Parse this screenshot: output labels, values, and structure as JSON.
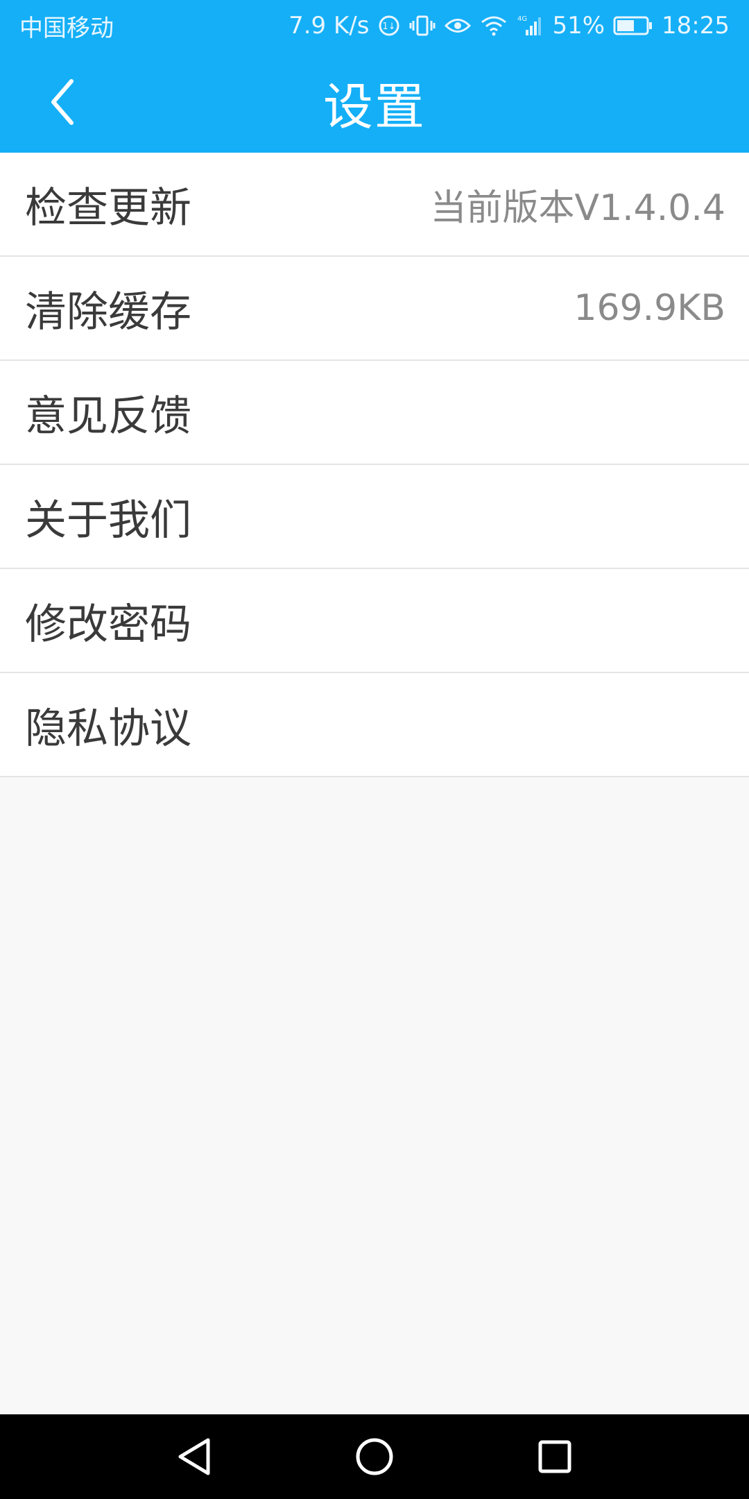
{
  "status_bar": {
    "carrier": "中国移动",
    "net_speed": "7.9 K/s",
    "signal_type": "4G",
    "battery": "51%",
    "time": "18:25",
    "icons": [
      "data-saver-icon",
      "vibrate-icon",
      "eye-comfort-icon",
      "wifi-icon",
      "cellular-signal-icon",
      "battery-icon"
    ]
  },
  "header": {
    "title": "设置",
    "back_icon": "chevron-left-icon"
  },
  "settings": {
    "items": [
      {
        "label": "检查更新",
        "value": "当前版本V1.4.0.4"
      },
      {
        "label": "清除缓存",
        "value": "169.9KB"
      },
      {
        "label": "意见反馈",
        "value": ""
      },
      {
        "label": "关于我们",
        "value": ""
      },
      {
        "label": "修改密码",
        "value": ""
      },
      {
        "label": "隐私协议",
        "value": ""
      }
    ]
  },
  "nav_bar": {
    "buttons": [
      "back-triangle-icon",
      "home-circle-icon",
      "recents-square-icon"
    ]
  },
  "colors": {
    "header_bg": "#14aff7",
    "page_bg": "#f8f8f8",
    "row_bg": "#ffffff",
    "label_text": "#3a3a3a",
    "value_text": "#8a8a8a"
  }
}
